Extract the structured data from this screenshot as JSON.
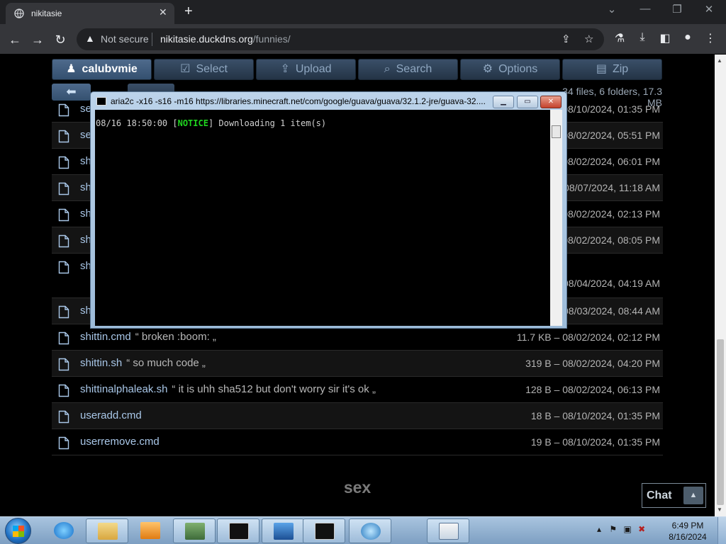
{
  "browser": {
    "tab_title": "nikitasie",
    "security_label": "Not secure",
    "url_host": "nikitasie.duckdns.org",
    "url_path": "/funnies/"
  },
  "nav": {
    "user": "calubvmie",
    "select": "Select",
    "upload": "Upload",
    "search": "Search",
    "options": "Options",
    "zip": "Zip"
  },
  "summary": "34 files, 6 folders, 17.3 MB",
  "rows": [
    {
      "name": "se",
      "comment": "",
      "meta": "08/10/2024, 01:35 PM"
    },
    {
      "name": "se",
      "comment": "",
      "meta": "08/02/2024, 05:51 PM"
    },
    {
      "name": "sh",
      "comment": "",
      "meta": "08/02/2024, 06:01 PM"
    },
    {
      "name": "sh",
      "comment": "",
      "meta": "08/07/2024, 11:18 AM"
    },
    {
      "name": "sh",
      "comment": "",
      "meta": "08/02/2024, 02:13 PM"
    },
    {
      "name": "sh",
      "comment": "",
      "meta": "08/02/2024, 08:05 PM"
    },
    {
      "name": "sh",
      "comment": "",
      "meta": "08/04/2024, 04:19 AM"
    },
    {
      "name": "sh",
      "comment": "",
      "meta": "08/03/2024, 08:44 AM"
    },
    {
      "name": "shittin.cmd",
      "comment": "“ broken :boom: „",
      "meta": "11.7 KB – 08/02/2024, 02:12 PM"
    },
    {
      "name": "shittin.sh",
      "comment": "“ so much code „",
      "meta": "319 B – 08/02/2024, 04:20 PM"
    },
    {
      "name": "shittinalphaleak.sh",
      "comment": "“ it is uhh sha512 but don't worry sir it's ok „",
      "meta": "128 B – 08/02/2024, 06:13 PM"
    },
    {
      "name": "useradd.cmd",
      "comment": "",
      "meta": "18 B – 08/10/2024, 01:35 PM"
    },
    {
      "name": "userremove.cmd",
      "comment": "",
      "meta": "19 B – 08/10/2024, 01:35 PM"
    }
  ],
  "footer_text": "sex",
  "chat_label": "Chat",
  "console": {
    "title": "aria2c  -x16 -s16 -m16 https://libraries.minecraft.net/com/google/guava/guava/32.1.2-jre/guava-32....",
    "line_time": "08/16 18:50:00 [",
    "line_tag": "NOTICE",
    "line_rest": "] Downloading 1 item(s)"
  },
  "taskbar": {
    "time": "6:49 PM",
    "date": "8/16/2024"
  },
  "colors": {
    "page_bg": "#000000",
    "nav_button": "#2e4259",
    "link": "#a9c7e8",
    "notice_green": "#1fd51f"
  }
}
